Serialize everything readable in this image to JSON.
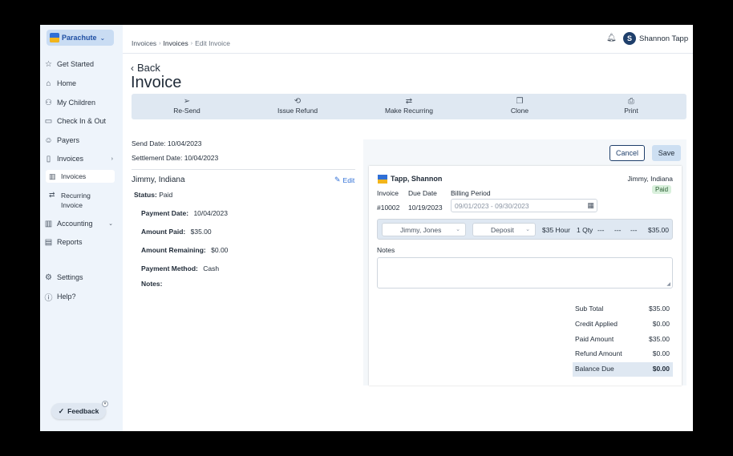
{
  "sidebar": {
    "brand": "Parachute",
    "items": [
      {
        "label": "Get Started"
      },
      {
        "label": "Home"
      },
      {
        "label": "My Children"
      },
      {
        "label": "Check In & Out"
      },
      {
        "label": "Payers"
      },
      {
        "label": "Invoices"
      },
      {
        "label": "Accounting"
      },
      {
        "label": "Reports"
      },
      {
        "label": "Settings"
      },
      {
        "label": "Help?"
      }
    ],
    "invoice_sub": [
      {
        "label": "Invoices"
      },
      {
        "label": "Recurring Invoice"
      }
    ],
    "feedback_label": "Feedback"
  },
  "topbar": {
    "crumbs": [
      "Invoices",
      "Invoices",
      "Edit Invoice"
    ],
    "user_initial": "S",
    "user_name": "Shannon Tapp"
  },
  "header": {
    "back_label": "Back",
    "title": "Invoice"
  },
  "actions": [
    {
      "label": "Re-Send",
      "icon": "send-icon"
    },
    {
      "label": "Issue Refund",
      "icon": "refund-icon"
    },
    {
      "label": "Make Recurring",
      "icon": "recurring-icon"
    },
    {
      "label": "Clone",
      "icon": "clone-icon"
    },
    {
      "label": "Print",
      "icon": "print-icon"
    }
  ],
  "details": {
    "send_date_label": "Send Date:",
    "send_date": "10/04/2023",
    "settlement_label": "Settlement Date:",
    "settlement_date": "10/04/2023",
    "payer_name": "Jimmy, Indiana",
    "edit_label": "Edit",
    "status_label": "Status:",
    "status": "Paid",
    "payment_date_label": "Payment Date:",
    "payment_date": "10/04/2023",
    "amount_paid_label": "Amount Paid:",
    "amount_paid": "$35.00",
    "amount_remaining_label": "Amount Remaining:",
    "amount_remaining": "$0.00",
    "payment_method_label": "Payment Method:",
    "payment_method": "Cash",
    "notes_label": "Notes:"
  },
  "editor": {
    "cancel_label": "Cancel",
    "save_label": "Save",
    "company": "Tapp, Shannon",
    "billed_to": "Jimmy, Indiana",
    "paid_badge": "Paid",
    "invoice_label": "Invoice",
    "invoice_number": "#10002",
    "due_date_label": "Due Date",
    "due_date": "10/19/2023",
    "billing_period_label": "Billing Period",
    "billing_period_placeholder": "09/01/2023 - 09/30/2023",
    "line": {
      "child": "Jimmy, Jones",
      "type": "Deposit",
      "rate": "$35 Hour",
      "qty": "1 Qty",
      "dash1": "---",
      "dash2": "---",
      "dash3": "---",
      "amount": "$35.00"
    },
    "notes_label": "Notes",
    "totals": [
      {
        "label": "Sub Total",
        "value": "$35.00"
      },
      {
        "label": "Credit Applied",
        "value": "$0.00"
      },
      {
        "label": "Paid Amount",
        "value": "$35.00"
      },
      {
        "label": "Refund Amount",
        "value": "$0.00"
      },
      {
        "label": "Balance Due",
        "value": "$0.00"
      }
    ]
  }
}
